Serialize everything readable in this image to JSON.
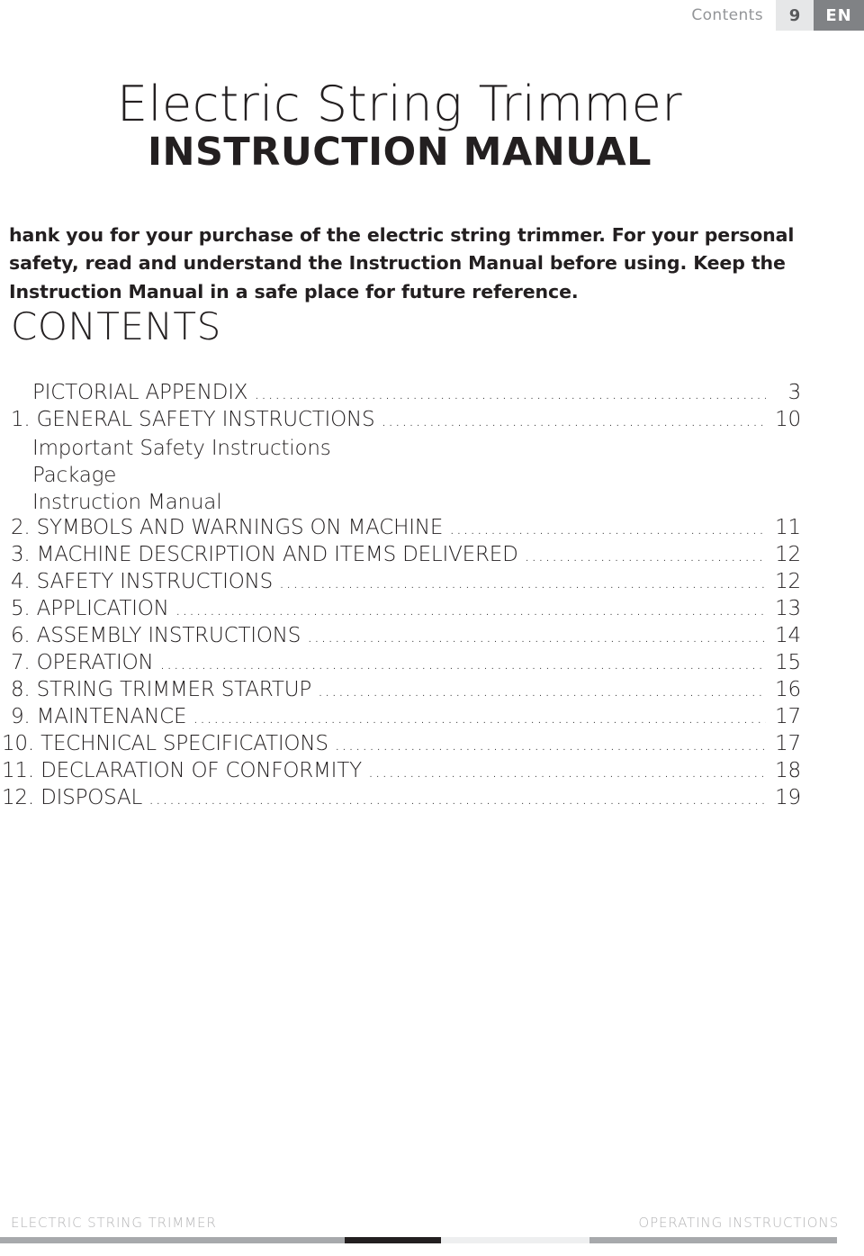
{
  "header": {
    "section_label": "Contents",
    "page_number": "9",
    "language": "EN"
  },
  "title": {
    "main": "Electric String Trimmer",
    "sub": "INSTRUCTION MANUAL"
  },
  "intro": {
    "paragraph": "hank you for your purchase of the electric string trimmer. For your personal safety, read and understand the Instruction Manual before using. Keep the Instruction Manual in a safe place for future reference."
  },
  "contents": {
    "heading": "CONTENTS",
    "entries": [
      {
        "label": "PICTORIAL APPENDIX",
        "page": "3",
        "style": "indent-1"
      },
      {
        "label": "1. GENERAL SAFETY INSTRUCTIONS",
        "page": "10",
        "style": ""
      },
      {
        "label": "Important Safety Instructions",
        "page": "",
        "style": "indent-sub no-leader"
      },
      {
        "label": "Package",
        "page": "",
        "style": "indent-sub no-leader"
      },
      {
        "label": "Instruction Manual",
        "page": "",
        "style": "indent-sub no-leader"
      },
      {
        "label": "2. SYMBOLS AND WARNINGS ON MACHINE",
        "page": "11",
        "style": ""
      },
      {
        "label": "3. MACHINE DESCRIPTION AND ITEMS DELIVERED",
        "page": "12",
        "style": ""
      },
      {
        "label": "4. SAFETY INSTRUCTIONS",
        "page": "12",
        "style": ""
      },
      {
        "label": "5. APPLICATION",
        "page": "13",
        "style": ""
      },
      {
        "label": "6. ASSEMBLY INSTRUCTIONS",
        "page": "14",
        "style": ""
      },
      {
        "label": "7. OPERATION",
        "page": "15",
        "style": ""
      },
      {
        "label": "8. STRING TRIMMER STARTUP",
        "page": "16",
        "style": ""
      },
      {
        "label": "9. MAINTENANCE",
        "page": "17",
        "style": ""
      },
      {
        "label": "10. TECHNICAL SPECIFICATIONS",
        "page": "17",
        "style": "outdent"
      },
      {
        "label": "11. DECLARATION OF CONFORMITY",
        "page": "18",
        "style": "outdent"
      },
      {
        "label": "12. DISPOSAL",
        "page": "19",
        "style": "outdent"
      }
    ]
  },
  "footer": {
    "left": "ELECTRIC STRING TRIMMER",
    "right": "OPERATING INSTRUCTIONS"
  },
  "colors": {
    "text": "#231f20",
    "header_label": "#939598",
    "page_chip_bg": "#e6e7e8",
    "lang_chip_bg": "#808285",
    "footer_text": "#b4b4b6",
    "bar_gray": "#a7a9ac",
    "bar_black": "#231f20",
    "bar_light": "#eeeff0"
  }
}
